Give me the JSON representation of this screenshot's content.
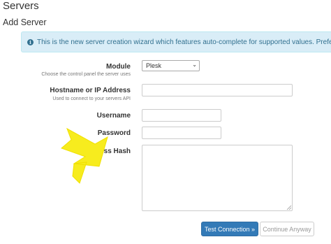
{
  "header": {
    "title": "Servers",
    "subtitle": "Add Server"
  },
  "info_banner": {
    "icon": "info-icon",
    "text": "This is the new server creation wizard which features auto-complete for supported values. Prefer the previous expe"
  },
  "form": {
    "module": {
      "label": "Module",
      "help": "Choose the control panel the server uses",
      "selected": "Plesk"
    },
    "hostname": {
      "label": "Hostname or IP Address",
      "help": "Used to connect to your servers API",
      "value": ""
    },
    "username": {
      "label": "Username",
      "value": ""
    },
    "password": {
      "label": "Password",
      "value": ""
    },
    "access_hash": {
      "label": "Access Hash",
      "value": ""
    }
  },
  "buttons": {
    "test_connection": "Test Connection »",
    "continue_anyway": "Continue Anyway"
  },
  "annotation": {
    "icon": "yellow-arrow-icon",
    "color": "#f7ec1e"
  }
}
